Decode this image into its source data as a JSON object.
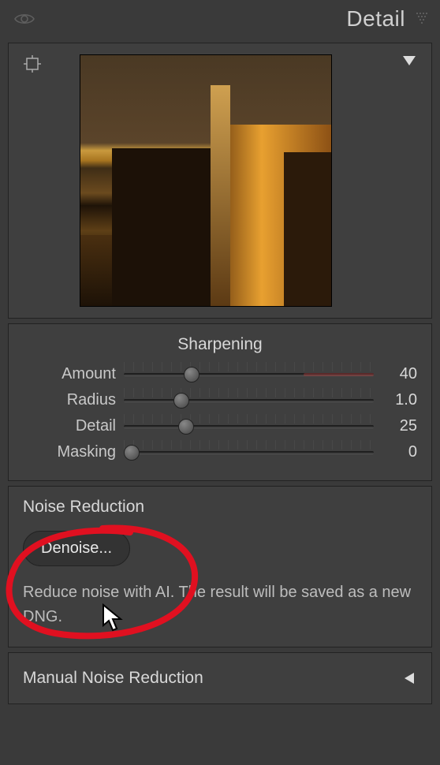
{
  "header": {
    "title": "Detail"
  },
  "sharpening": {
    "title": "Sharpening",
    "sliders": [
      {
        "label": "Amount",
        "value": "40",
        "pos": 27,
        "warn": true
      },
      {
        "label": "Radius",
        "value": "1.0",
        "pos": 23,
        "warn": false
      },
      {
        "label": "Detail",
        "value": "25",
        "pos": 25,
        "warn": false
      },
      {
        "label": "Masking",
        "value": "0",
        "pos": 3,
        "warn": false
      }
    ]
  },
  "noise": {
    "title": "Noise Reduction",
    "button": "Denoise...",
    "description": "Reduce noise with AI. The result will be saved as a new DNG."
  },
  "manual": {
    "title": "Manual Noise Reduction"
  }
}
